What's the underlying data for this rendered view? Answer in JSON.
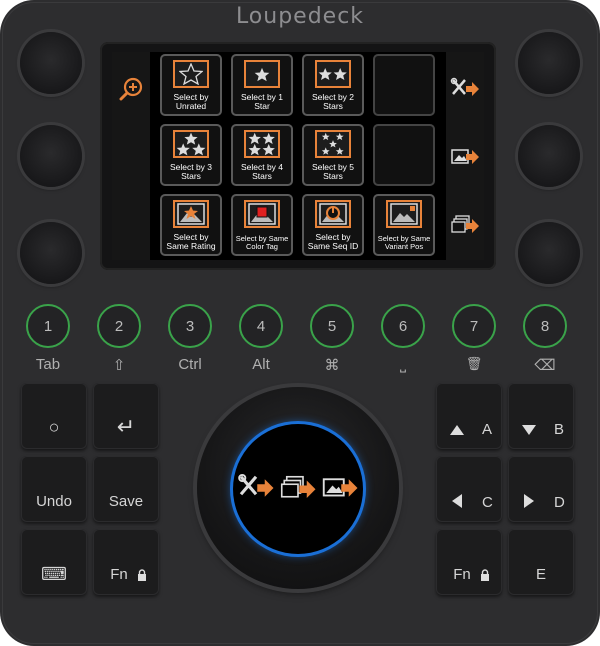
{
  "brand": {
    "logo_text": "Loupedeck"
  },
  "screen": {
    "left_icons": [
      {
        "icon": "zoom-in-icon"
      }
    ],
    "right_icons": [
      {
        "icon": "tools-arrow-icon"
      },
      {
        "icon": "image-arrow-icon"
      },
      {
        "icon": "stack-arrow-icon"
      }
    ],
    "cells": [
      {
        "label_1": "Select by",
        "label_2": "Unrated",
        "icon": "outline-star-icon"
      },
      {
        "label_1": "Select by 1",
        "label_2": "Star",
        "icon": "one-star-icon"
      },
      {
        "label_1": "Select by 2",
        "label_2": "Stars",
        "icon": "two-stars-icon"
      },
      {
        "label_1": "",
        "label_2": "",
        "icon": "empty"
      },
      {
        "label_1": "Select by 3",
        "label_2": "Stars",
        "icon": "three-stars-icon"
      },
      {
        "label_1": "Select by 4",
        "label_2": "Stars",
        "icon": "four-stars-icon"
      },
      {
        "label_1": "Select by 5",
        "label_2": "Stars",
        "icon": "five-stars-icon"
      },
      {
        "label_1": "",
        "label_2": "",
        "icon": "empty"
      },
      {
        "label_1": "Select by",
        "label_2": "Same Rating",
        "icon": "image-star-icon"
      },
      {
        "label_1": "Select by Same",
        "label_2": "Color Tag",
        "icon": "image-color-tag-icon"
      },
      {
        "label_1": "Select by",
        "label_2": "Same Seq ID",
        "icon": "image-sequence-icon"
      },
      {
        "label_1": "Select by Same",
        "label_2": "Variant Pos",
        "icon": "image-variant-icon"
      }
    ]
  },
  "number_buttons": [
    {
      "number": "1",
      "label": "Tab"
    },
    {
      "number": "2",
      "label": "⇧"
    },
    {
      "number": "3",
      "label": "Ctrl"
    },
    {
      "number": "4",
      "label": "Alt"
    },
    {
      "number": "5",
      "label": "⌘"
    },
    {
      "number": "6",
      "label": "⎵"
    },
    {
      "number": "7",
      "label": "🗑"
    },
    {
      "number": "8",
      "label": "⌫"
    }
  ],
  "left_keys": {
    "circle": "○",
    "enter": "↵",
    "undo": "Undo",
    "save": "Save",
    "keyboard": "⌨",
    "fn": "Fn"
  },
  "right_keys": {
    "up_letter": "A",
    "down_letter": "B",
    "left_letter": "C",
    "right_letter": "D",
    "fn": "Fn",
    "e": "E"
  },
  "dial": {
    "icons": [
      "tools-arrow-icon",
      "stack-arrow-icon",
      "image-arrow-icon"
    ]
  },
  "colors": {
    "accent_orange": "#e8833a",
    "ring_green": "#3aa34a",
    "dial_blue": "#1a6fd6",
    "tag_red": "#e02020"
  }
}
